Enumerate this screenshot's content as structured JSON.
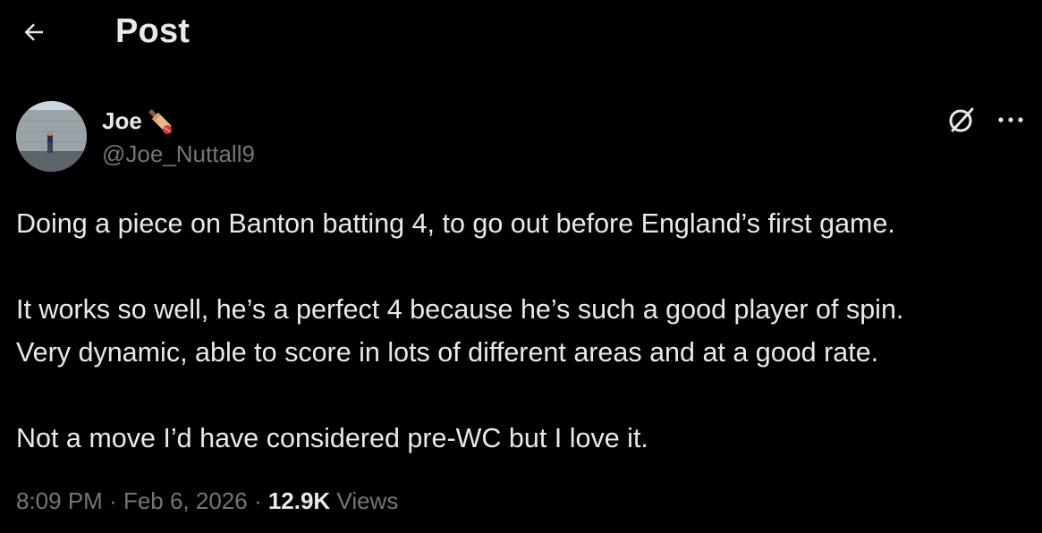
{
  "header": {
    "title": "Post",
    "back_icon": "arrow-left-icon"
  },
  "post": {
    "author": {
      "display_name": "Joe",
      "name_emoji": "cricket-bat-icon",
      "handle": "@Joe_Nuttall9",
      "avatar": "avatar"
    },
    "actions": {
      "grok_icon": "grok-icon",
      "more_icon": "more-icon"
    },
    "text": {
      "line1": "Doing a piece on Banton batting 4, to go out before England’s first game.",
      "line2": "It works so well, he’s a perfect 4 because he’s such a good player of spin.",
      "line3": "Very dynamic, able to score in lots of different areas and at a good rate.",
      "line4": "Not a move I’d have considered pre-WC but I love it."
    },
    "meta": {
      "time": "8:09 PM",
      "separator1": " · ",
      "date": "Feb 6, 2026",
      "separator2": " · ",
      "views_count": "12.9K",
      "views_label": " Views"
    }
  },
  "colors": {
    "background": "#000000",
    "primary_text": "#e7e9ea",
    "secondary_text": "#71767b"
  }
}
